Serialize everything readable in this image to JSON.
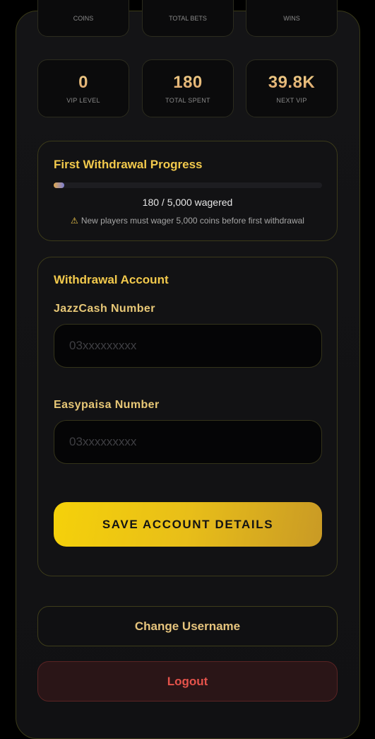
{
  "stats_top": [
    {
      "label": "COINS"
    },
    {
      "label": "TOTAL BETS"
    },
    {
      "label": "WINS"
    }
  ],
  "stats": [
    {
      "value": "0",
      "label": "VIP LEVEL"
    },
    {
      "value": "180",
      "label": "TOTAL SPENT"
    },
    {
      "value": "39.8K",
      "label": "NEXT VIP"
    }
  ],
  "progress": {
    "title": "First Withdrawal Progress",
    "wagered": 180,
    "target": 5000,
    "fraction": 0.036,
    "text": "180 / 5,000 wagered",
    "notice_icon": "warning-icon",
    "notice": "New players must wager 5,000 coins before first withdrawal"
  },
  "withdrawal": {
    "title": "Withdrawal Account",
    "jazzcash_label": "JazzCash Number",
    "jazzcash_placeholder": "03xxxxxxxxx",
    "easypaisa_label": "Easypaisa Number",
    "easypaisa_placeholder": "03xxxxxxxxx",
    "save_label": "SAVE ACCOUNT DETAILS"
  },
  "actions": {
    "change_username": "Change Username",
    "logout": "Logout"
  },
  "colors": {
    "accent": "#f2c94c",
    "danger": "#e5534b",
    "background": "#000000"
  }
}
